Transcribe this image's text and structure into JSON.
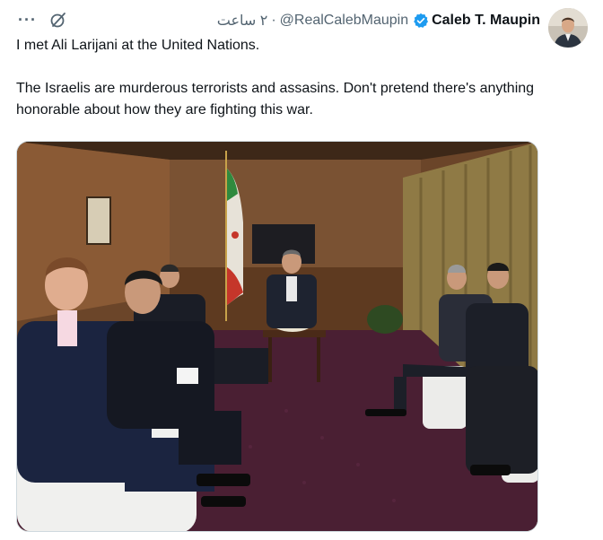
{
  "tweet": {
    "author": {
      "display_name": "Caleb T. Maupin",
      "handle": "@RealCalebMaupin",
      "verified": true,
      "avatar_icon": "profile-photo"
    },
    "time": "۲ ساعت",
    "separator": "·",
    "more_label": "···",
    "text_line1": "I met Ali Larijani at the United Nations.",
    "text_line2": "The Israelis are murderous terrorists and assasins. Don't pretend there's anything honorable about how they are fighting this war.",
    "media": {
      "type": "photo",
      "icon": "photo"
    },
    "colors": {
      "verified": "#1d9bf0",
      "text": "#0f1419",
      "muted": "#536471"
    }
  }
}
